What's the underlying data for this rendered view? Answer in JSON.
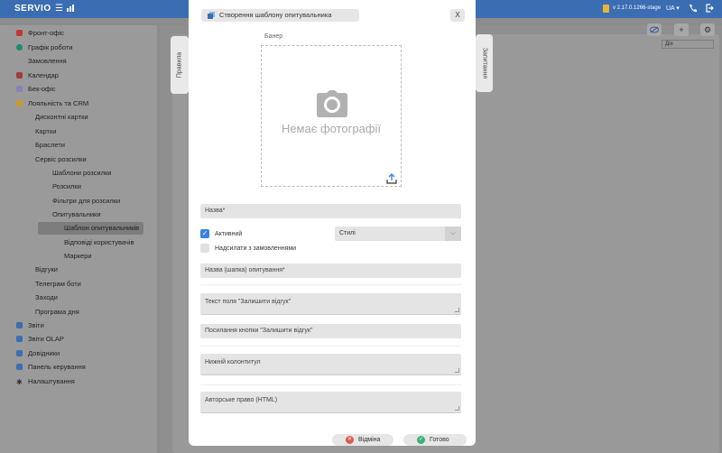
{
  "topbar": {
    "brand": "SERVIO",
    "version": "v 2.17.0.1266-stage",
    "language": "UA"
  },
  "colors": {
    "topbar": "#3b6db3",
    "accent": "#3b82e0",
    "cancel": "#e05a4f",
    "ok": "#3fb07a"
  },
  "sidebar": {
    "items": [
      {
        "label": "Фронт-офіс",
        "icon": "front-office-icon"
      },
      {
        "label": "Графік роботи",
        "icon": "clock-icon"
      },
      {
        "label": "Замовлення",
        "icon": ""
      },
      {
        "label": "Календар",
        "icon": "calendar-icon"
      },
      {
        "label": "Бек-офіс",
        "icon": "back-office-icon"
      },
      {
        "label": "Лояльність та CRM",
        "icon": "loyalty-icon"
      },
      {
        "label": "Дисконтні картки",
        "icon": ""
      },
      {
        "label": "Картки",
        "icon": ""
      },
      {
        "label": "Браслети",
        "icon": ""
      },
      {
        "label": "Сервіс розсилки",
        "icon": ""
      },
      {
        "label": "Шаблони розсилки",
        "icon": ""
      },
      {
        "label": "Розсилки",
        "icon": ""
      },
      {
        "label": "Фільтри для розсилки",
        "icon": ""
      },
      {
        "label": "Опитувальники",
        "icon": ""
      },
      {
        "label": "Шаблон опитувальників",
        "icon": "",
        "selected": true
      },
      {
        "label": "Відповіді користувачів",
        "icon": ""
      },
      {
        "label": "Маркери",
        "icon": ""
      },
      {
        "label": "Відгуки",
        "icon": ""
      },
      {
        "label": "Телеграм боти",
        "icon": ""
      },
      {
        "label": "Заходи",
        "icon": ""
      },
      {
        "label": "Програма дня",
        "icon": ""
      },
      {
        "label": "Звіти",
        "icon": "reports-icon"
      },
      {
        "label": "Звіти OLAP",
        "icon": "olap-icon"
      },
      {
        "label": "Довідники",
        "icon": "directories-icon"
      },
      {
        "label": "Панель керування",
        "icon": "control-panel-icon"
      },
      {
        "label": "Налаштування",
        "icon": "gear-icon"
      }
    ]
  },
  "background": {
    "left_tab": "Правила",
    "right_tab": "Запитання",
    "column_header": "Дія"
  },
  "modal": {
    "title": "Створення шаблону опитувальника",
    "close": "X",
    "banner_label": "Банер",
    "no_photo": "Немає фотографії",
    "name_placeholder": "Назва*",
    "active_label": "Активний",
    "active_checked": true,
    "send_with_orders_label": "Надсилати з замовленнями",
    "send_with_orders_checked": false,
    "styles_select": "Стилі",
    "header_placeholder": "Назва (шапка) опитування*",
    "feedback_text_placeholder": "Текст поля \"Залишити відгук\"",
    "feedback_button_placeholder": "Посилання кнопки \"Залишити відгук\"",
    "footer_placeholder": "Нижній колонтитул",
    "copyright_placeholder": "Авторське право (HTML)",
    "cancel_label": "Відміна",
    "ok_label": "Готово"
  }
}
